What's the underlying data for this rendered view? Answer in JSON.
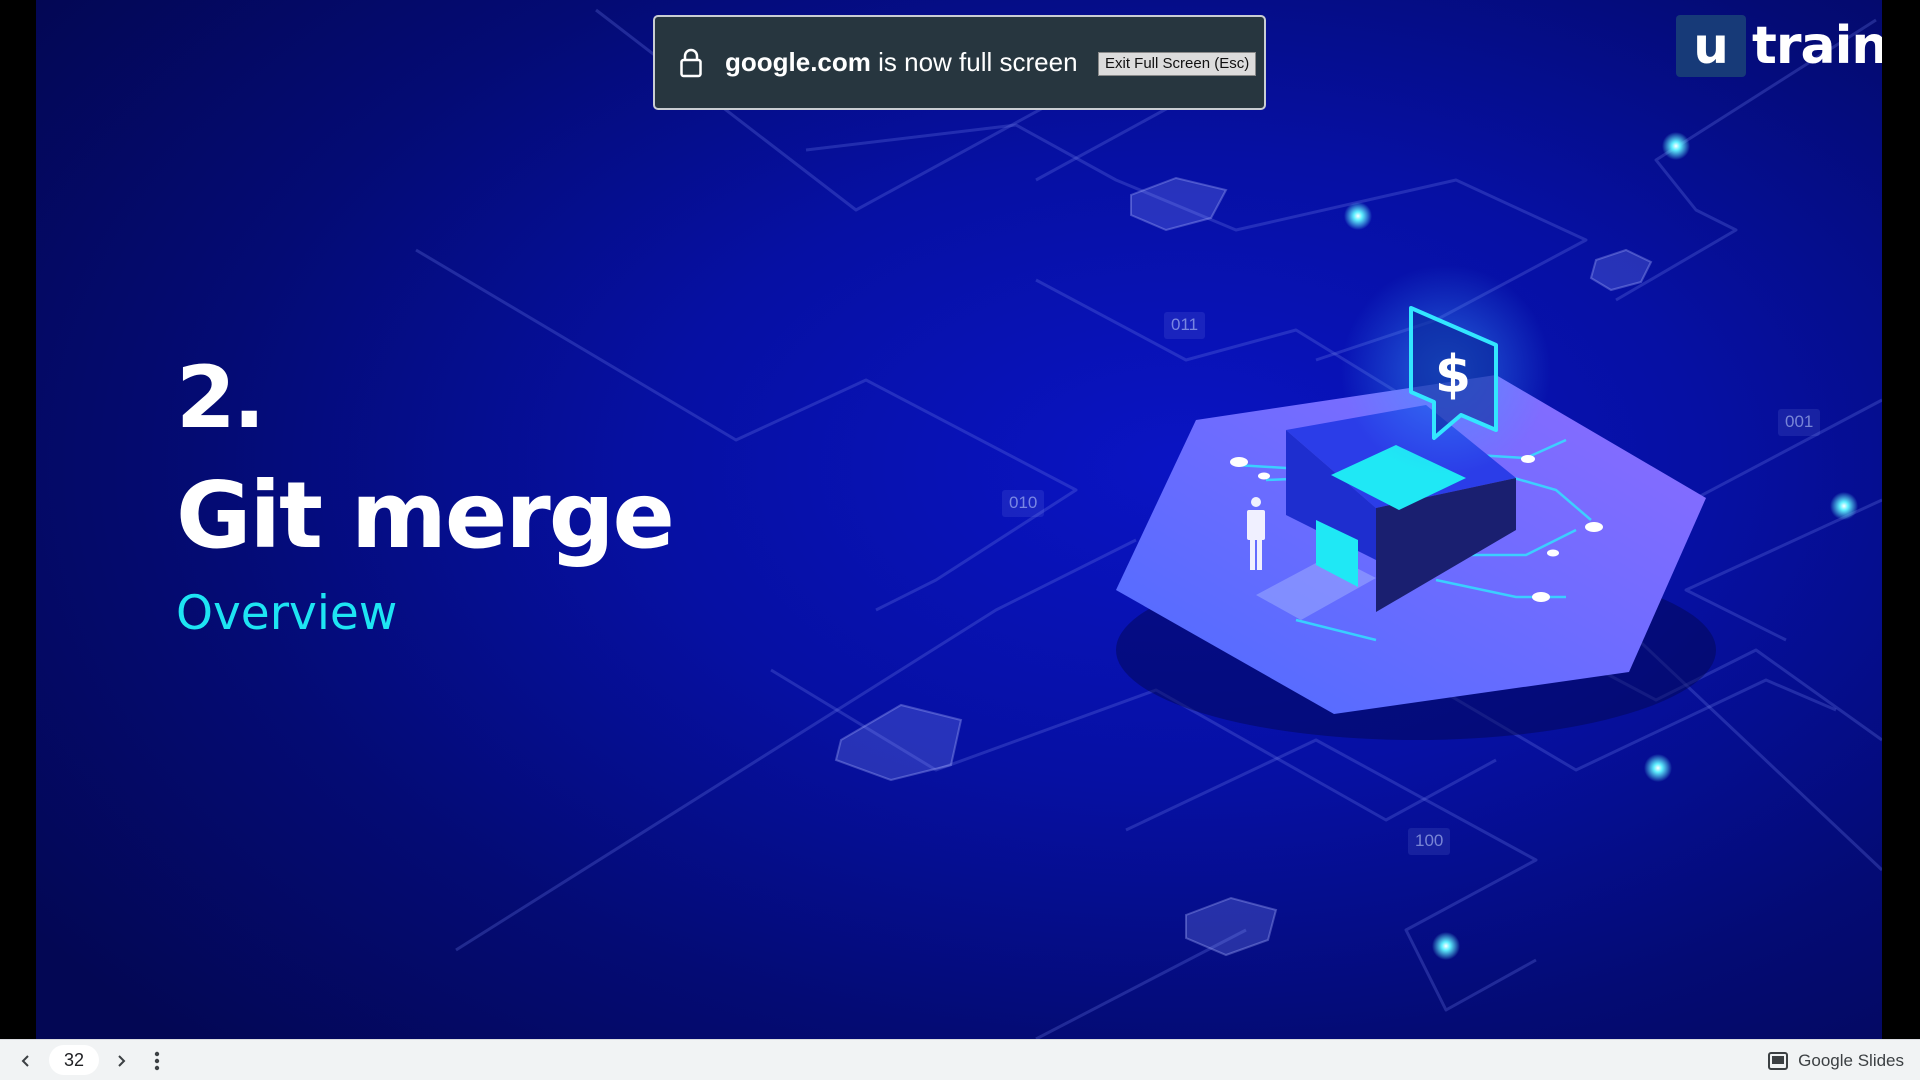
{
  "slide": {
    "number": "2.",
    "title": "Git merge",
    "subtitle": "Overview",
    "logo": {
      "mark": "u",
      "text": "train",
      "box_color": "#173a78"
    },
    "binary_labels": [
      "011",
      "010",
      "001",
      "100"
    ],
    "illustration": "dollar-hub-icon",
    "colors": {
      "background": "#0610a3",
      "subtitle": "#1ee4f3",
      "accent": "#1ee4f3"
    }
  },
  "fullscreen_banner": {
    "domain": "google.com",
    "message": "is now full screen",
    "exit_label": "Exit Full Screen (Esc)"
  },
  "bottom_bar": {
    "page_number": "32",
    "app_label": "Google Slides"
  }
}
